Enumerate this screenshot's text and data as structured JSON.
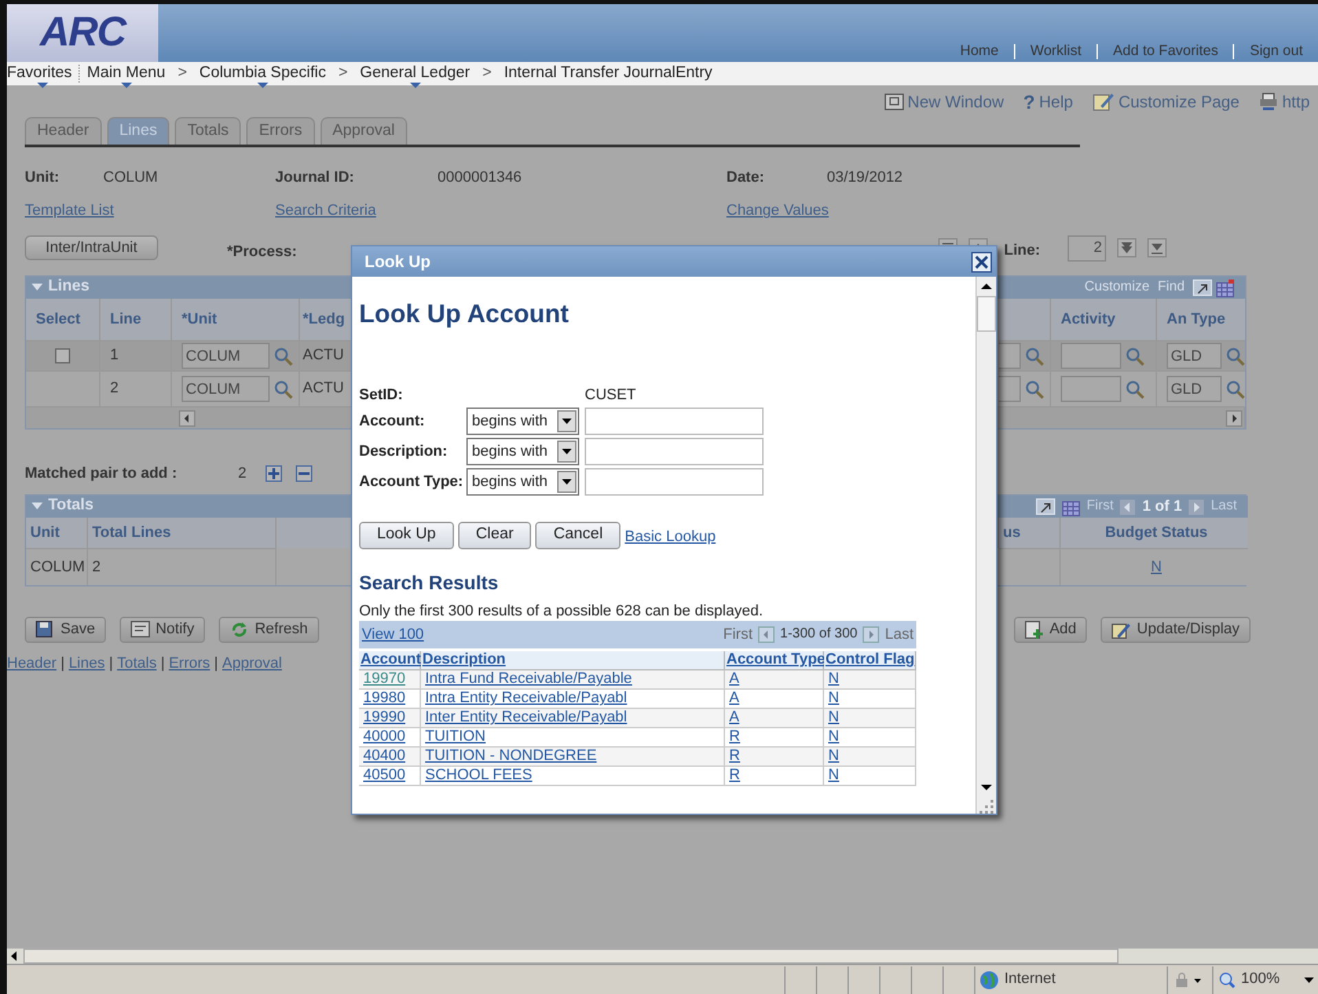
{
  "header": {
    "logo": "ARC",
    "links": [
      "Home",
      "Worklist",
      "Add to Favorites",
      "Sign out"
    ]
  },
  "breadcrumb": [
    {
      "kind": "menu",
      "label": "Favorites"
    },
    {
      "kind": "menu",
      "label": "Main Menu"
    },
    {
      "kind": "separator",
      "label": ">"
    },
    {
      "kind": "menu",
      "label": "Columbia Specific"
    },
    {
      "kind": "separator",
      "label": ">"
    },
    {
      "kind": "menu",
      "label": "General Ledger"
    },
    {
      "kind": "separator",
      "label": ">"
    },
    {
      "kind": "page",
      "label": "Internal Transfer JournalEntry"
    }
  ],
  "page_tools": [
    {
      "kind": "new_window",
      "label": "New Window"
    },
    {
      "kind": "help",
      "glyph": "?",
      "label": "Help"
    },
    {
      "kind": "customize",
      "label": "Customize Page"
    },
    {
      "kind": "http",
      "label": "http"
    }
  ],
  "tabs": [
    {
      "label": "Header",
      "selected": false
    },
    {
      "label": "Lines",
      "selected": true
    },
    {
      "label": "Totals",
      "selected": false
    },
    {
      "label": "Errors",
      "selected": false
    },
    {
      "label": "Approval",
      "selected": false
    }
  ],
  "journal": {
    "fields": [
      {
        "label": "Unit:",
        "value": "COLUM"
      },
      {
        "label": "Journal ID:",
        "value": "0000001346"
      },
      {
        "label": "Date:",
        "value": "03/19/2012"
      }
    ],
    "links": [
      "Template List",
      "Search Criteria",
      "Change Values"
    ],
    "button": "Inter/IntraUnit",
    "process_label": "*Process:",
    "line_label": "Line:",
    "line_value": "2"
  },
  "lines_grid": {
    "title": "Lines",
    "tools": [
      "Customize",
      "Find"
    ],
    "columns_left": [
      "Select",
      "Line",
      "*Unit",
      "*Ledg"
    ],
    "columns_right": [
      "Activity",
      "An Type"
    ],
    "rows": [
      {
        "kind": "selectable",
        "checked": false,
        "line": "1",
        "unit": "COLUM",
        "ledger": "ACTU",
        "an_type": "GLD"
      },
      {
        "kind": "plain",
        "line": "2",
        "unit": "COLUM",
        "ledger": "ACTU",
        "an_type": "GLD"
      }
    ]
  },
  "matched_pair": {
    "label": "Matched pair to add :",
    "value": "2"
  },
  "totals_grid": {
    "title": "Totals",
    "first": "First",
    "range": "1 of 1",
    "last": "Last",
    "columns_left": [
      "Unit",
      "Total Lines"
    ],
    "columns_right": [
      "us",
      "Budget Status"
    ],
    "rows": [
      {
        "unit": "COLUM",
        "total_lines": "2",
        "budget_status": "N"
      }
    ]
  },
  "actions_left": [
    {
      "kind": "save",
      "label": "Save"
    },
    {
      "kind": "notify",
      "label": "Notify"
    },
    {
      "kind": "refresh",
      "label": "Refresh"
    }
  ],
  "actions_right": [
    {
      "kind": "add",
      "label": "Add"
    },
    {
      "kind": "update",
      "label": "Update/Display"
    }
  ],
  "footer_links": [
    {
      "kind": "link",
      "label": "Header"
    },
    {
      "kind": "separator",
      "label": "|"
    },
    {
      "kind": "link",
      "label": "Lines"
    },
    {
      "kind": "separator",
      "label": "|"
    },
    {
      "kind": "link",
      "label": "Totals"
    },
    {
      "kind": "separator",
      "label": "|"
    },
    {
      "kind": "link",
      "label": "Errors"
    },
    {
      "kind": "separator",
      "label": "|"
    },
    {
      "kind": "link",
      "label": "Approval"
    }
  ],
  "modal": {
    "title": "Look Up",
    "heading": "Look Up Account",
    "setid_label": "SetID:",
    "setid_value": "CUSET",
    "criteria": [
      {
        "label": "Account:",
        "operator": "begins with"
      },
      {
        "label": "Description:",
        "operator": "begins with"
      },
      {
        "label": "Account Type:",
        "operator": "begins with"
      }
    ],
    "buttons": [
      "Look Up",
      "Clear",
      "Cancel"
    ],
    "link": "Basic Lookup",
    "results_title": "Search Results",
    "note": "Only the first 300 results of a possible 628 can be displayed.",
    "view_link": "View 100",
    "first": "First",
    "range": "1-300 of 300",
    "last": "Last",
    "columns": [
      "Account",
      "Description",
      "Account Type",
      "Control Flag"
    ],
    "rows": [
      {
        "account": "19970",
        "description": "Intra Fund Receivable/Payable",
        "type": "A",
        "flag": "N"
      },
      {
        "account": "19980",
        "description": "Intra Entity Receivable/Payabl",
        "type": "A",
        "flag": "N"
      },
      {
        "account": "19990",
        "description": "Inter Entity Receivable/Payabl",
        "type": "A",
        "flag": "N"
      },
      {
        "account": "40000",
        "description": "TUITION",
        "type": "R",
        "flag": "N"
      },
      {
        "account": "40400",
        "description": "TUITION - NONDEGREE",
        "type": "R",
        "flag": "N"
      },
      {
        "account": "40500",
        "description": "SCHOOL FEES",
        "type": "R",
        "flag": "N"
      }
    ]
  },
  "status_bar": {
    "zone": "Internet",
    "zoom": "100%"
  }
}
